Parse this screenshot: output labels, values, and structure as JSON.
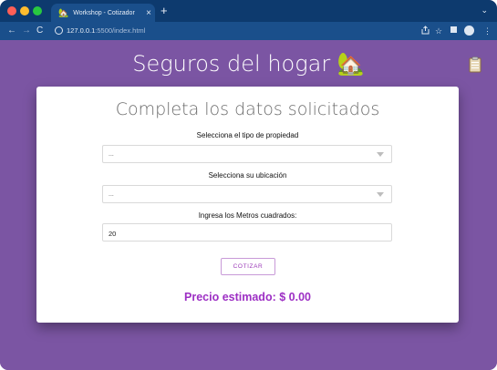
{
  "browser": {
    "tab_title": "Workshop - Cotizador",
    "tab_close": "×",
    "new_tab": "+",
    "tab_menu": "⌄",
    "url_host": "127.0.0.1",
    "url_rest": ":5500/index.html",
    "nav_back": "←",
    "nav_forward": "→",
    "nav_reload": "C",
    "icons": [
      "share-icon",
      "star-icon",
      "extensions-icon",
      "profile-icon",
      "more-icon"
    ]
  },
  "page": {
    "title": "Seguros del hogar",
    "title_emoji": "🏡",
    "background": "#7b55a3"
  },
  "card": {
    "title": "Completa los datos solicitados",
    "property_label": "Selecciona el tipo de propiedad",
    "property_value": "...",
    "location_label": "Selecciona su ubicación",
    "location_value": "...",
    "area_label": "Ingresa los Metros cuadrados:",
    "area_value": "20",
    "submit_label": "COTIZAR",
    "price_text": "Precio estimado: $ 0.00",
    "accent": "#9d2fc4"
  }
}
